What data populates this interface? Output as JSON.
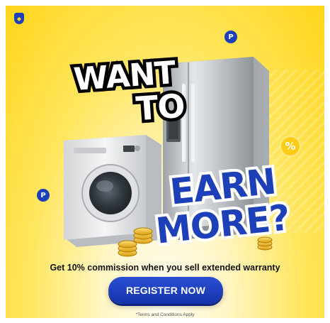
{
  "brand": {
    "logo_icon": "shield-logo-icon",
    "logo_color": "#1d3fb8"
  },
  "headline": {
    "line1": "WANT",
    "line2": "TO",
    "line3": "EARN",
    "line4": "MORE?"
  },
  "badges": {
    "p_label": "P",
    "percent_label": "%"
  },
  "tagline": "Get 10% commission when you sell extended warranty",
  "cta": {
    "label": "REGISTER NOW"
  },
  "terms": "*Terms and Conditions Apply",
  "colors": {
    "background": "#ffd51a",
    "accent": "#1d3fb8",
    "highlight": "#ffcc14"
  }
}
